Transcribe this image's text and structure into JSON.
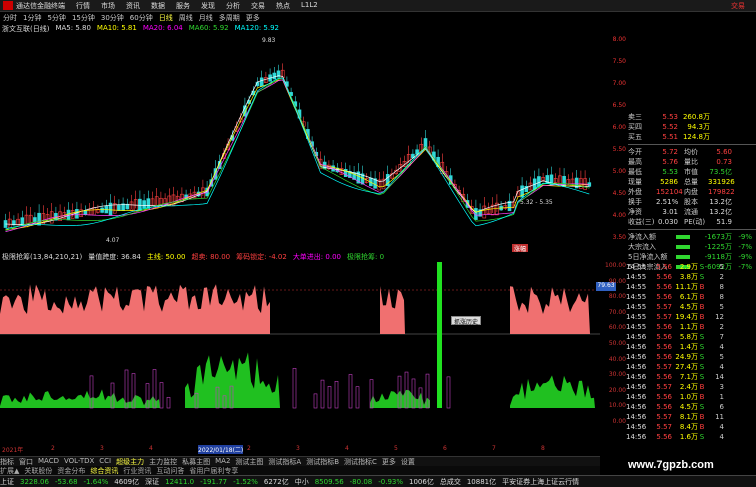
{
  "titlebar": {
    "app": "通达信金融终端",
    "menus": [
      "行情",
      "市场",
      "资讯",
      "数据",
      "服务",
      "发现",
      "分析",
      "交易",
      "热点",
      "L1L2"
    ],
    "right": "交易"
  },
  "toolbar": {
    "periods": [
      "分时",
      "1分钟",
      "5分钟",
      "15分钟",
      "30分钟",
      "60分钟",
      "日线",
      "周线",
      "月线",
      "多周期",
      "更多"
    ],
    "active": "日线"
  },
  "stock": {
    "name": "浙文互联(日线)",
    "ma": [
      {
        "label": "MA5: 5.80"
      },
      {
        "label": "MA10: 5.81"
      },
      {
        "label": "MA20: 6.04"
      },
      {
        "label": "MA60: 5.92"
      },
      {
        "label": "MA120: 5.92"
      }
    ],
    "high_label": "9.83",
    "low_label": "4.07",
    "range_label": "5.32 - 5.35",
    "tag": "涨幅"
  },
  "price_axis": [
    "8.00",
    "7.50",
    "7.00",
    "6.50",
    "6.00",
    "5.50",
    "5.00",
    "4.50",
    "4.00",
    "3.50"
  ],
  "indicator": {
    "title": "极限抢筹(13,84,210,21)",
    "items": [
      {
        "label": "量值跨度: 36.84",
        "cls": "w"
      },
      {
        "label": "主线: 50.00",
        "cls": "y"
      },
      {
        "label": "超卖: 80.00",
        "cls": "up"
      },
      {
        "label": "筹码锁定: -4.02",
        "cls": "up"
      },
      {
        "label": "大单进出: 0.00",
        "cls": "m"
      },
      {
        "label": "极限抢筹: 0",
        "cls": "dn"
      }
    ],
    "tip": "抓涨历史",
    "value": "79.63"
  },
  "ind_axis": [
    "100.00",
    "90.00",
    "80.00",
    "70.00",
    "60.00",
    "50.00",
    "40.00",
    "30.00",
    "20.00",
    "10.00",
    "0.00"
  ],
  "xaxis": {
    "labels": [
      "2021年",
      "2",
      "3",
      "4",
      "2022/01/18(二)",
      "2",
      "3",
      "4",
      "5",
      "6",
      "7",
      "8"
    ]
  },
  "tabs": {
    "items": [
      "指标",
      "窗口",
      "MACD",
      "VOL-TDX",
      "CCI",
      "超级主力",
      "主力监控",
      "私募主图",
      "MA2",
      "测试主图",
      "测试指标A",
      "测试指标B",
      "测试指标C",
      "更多",
      "设置"
    ],
    "active": "超级主力"
  },
  "links": {
    "items": [
      "扩展▲",
      "关联股份",
      "资金分布",
      "综合资讯",
      "行业资讯",
      "互动问答",
      "省用户届利专享"
    ],
    "hl": "综合资讯"
  },
  "quote": {
    "rows": [
      {
        "l": "卖三",
        "v": "5.53",
        "v2": "260.8万",
        "c": "up"
      },
      {
        "l": "买四",
        "v": "5.52",
        "v2": "94.3万",
        "c": "up"
      },
      {
        "l": "买五",
        "v": "5.51",
        "v2": "124.8万",
        "c": "up"
      }
    ],
    "stats": [
      {
        "l": "今开",
        "v": "5.72",
        "l2": "均价",
        "v3": "5.60",
        "c": "up"
      },
      {
        "l": "最高",
        "v": "5.76",
        "l2": "量比",
        "v3": "0.73",
        "c": "up"
      },
      {
        "l": "最低",
        "v": "5.53",
        "l2": "市值",
        "v3": "73.5亿",
        "c": "dn"
      },
      {
        "l": "现量",
        "v": "5286",
        "l2": "总量",
        "v3": "331926",
        "c": "y"
      },
      {
        "l": "外盘",
        "v": "152104",
        "l2": "内盘",
        "v3": "179822",
        "c": "up"
      },
      {
        "l": "换手",
        "v": "2.51%",
        "l2": "股本",
        "v3": "13.2亿",
        "c": "w"
      },
      {
        "l": "净资",
        "v": "3.01",
        "l2": "流通",
        "v3": "13.2亿",
        "c": "w"
      },
      {
        "l": "收益(三)",
        "v": "0.030",
        "l2": "PE(动)",
        "v3": "51.9",
        "c": "w"
      }
    ],
    "flows": [
      {
        "l": "净流入额",
        "v": "-1673万",
        "p": "-9%"
      },
      {
        "l": "大宗流入",
        "v": "-1225万",
        "p": "-7%"
      },
      {
        "l": "5日净流入额",
        "v": "-9118万",
        "p": "-9%"
      },
      {
        "l": "5日大宗流入",
        "v": "-6092万",
        "p": "-7%"
      }
    ]
  },
  "ticks": [
    {
      "t": "14:55",
      "p": "5.56",
      "q": "2.9万",
      "s": "S",
      "n": "5"
    },
    {
      "t": "14:55",
      "p": "5.56",
      "q": "3.8万",
      "s": "S",
      "n": "2"
    },
    {
      "t": "14:55",
      "p": "5.56",
      "q": "11.1万",
      "s": "B",
      "n": "8"
    },
    {
      "t": "14:55",
      "p": "5.56",
      "q": "6.1万",
      "s": "B",
      "n": "8"
    },
    {
      "t": "14:55",
      "p": "5.57",
      "q": "4.5万",
      "s": "B",
      "n": "5"
    },
    {
      "t": "14:55",
      "p": "5.57",
      "q": "19.4万",
      "s": "B",
      "n": "12"
    },
    {
      "t": "14:55",
      "p": "5.56",
      "q": "1.1万",
      "s": "B",
      "n": "2"
    },
    {
      "t": "14:56",
      "p": "5.56",
      "q": "5.8万",
      "s": "S",
      "n": "7"
    },
    {
      "t": "14:56",
      "p": "5.56",
      "q": "1.4万",
      "s": "S",
      "n": "4"
    },
    {
      "t": "14:56",
      "p": "5.56",
      "q": "24.9万",
      "s": "S",
      "n": "5"
    },
    {
      "t": "14:56",
      "p": "5.57",
      "q": "27.4万",
      "s": "S",
      "n": "4"
    },
    {
      "t": "14:56",
      "p": "5.56",
      "q": "7.1万",
      "s": "S",
      "n": "14"
    },
    {
      "t": "14:56",
      "p": "5.57",
      "q": "2.4万",
      "s": "B",
      "n": "3"
    },
    {
      "t": "14:56",
      "p": "5.56",
      "q": "1.0万",
      "s": "B",
      "n": "1"
    },
    {
      "t": "14:56",
      "p": "5.56",
      "q": "4.5万",
      "s": "S",
      "n": "6"
    },
    {
      "t": "14:56",
      "p": "5.57",
      "q": "8.1万",
      "s": "B",
      "n": "11"
    },
    {
      "t": "14:56",
      "p": "5.57",
      "q": "8.4万",
      "s": "B",
      "n": "4"
    },
    {
      "t": "14:56",
      "p": "5.56",
      "q": "1.6万",
      "s": "S",
      "n": "4"
    }
  ],
  "status": {
    "items": [
      {
        "label": "上证",
        "cls": "w"
      },
      {
        "label": "3228.06",
        "cls": "dn"
      },
      {
        "label": "-53.68",
        "cls": "dn"
      },
      {
        "label": "-1.64%",
        "cls": "dn"
      },
      {
        "label": "4609亿",
        "cls": "w"
      },
      {
        "label": "深证",
        "cls": "w"
      },
      {
        "label": "12411.0",
        "cls": "dn"
      },
      {
        "label": "-191.77",
        "cls": "dn"
      },
      {
        "label": "-1.52%",
        "cls": "dn"
      },
      {
        "label": "6272亿",
        "cls": "w"
      },
      {
        "label": "中小",
        "cls": "w"
      },
      {
        "label": "8509.56",
        "cls": "dn"
      },
      {
        "label": "-80.08",
        "cls": "dn"
      },
      {
        "label": "-0.93%",
        "cls": "dn"
      },
      {
        "label": "1006亿",
        "cls": "w"
      },
      {
        "label": "总成交",
        "cls": "w"
      },
      {
        "label": "10881亿",
        "cls": "w"
      },
      {
        "label": "平安证券上海上证云行情",
        "cls": "w"
      }
    ]
  },
  "watermark": "www.7gpzb.com"
}
